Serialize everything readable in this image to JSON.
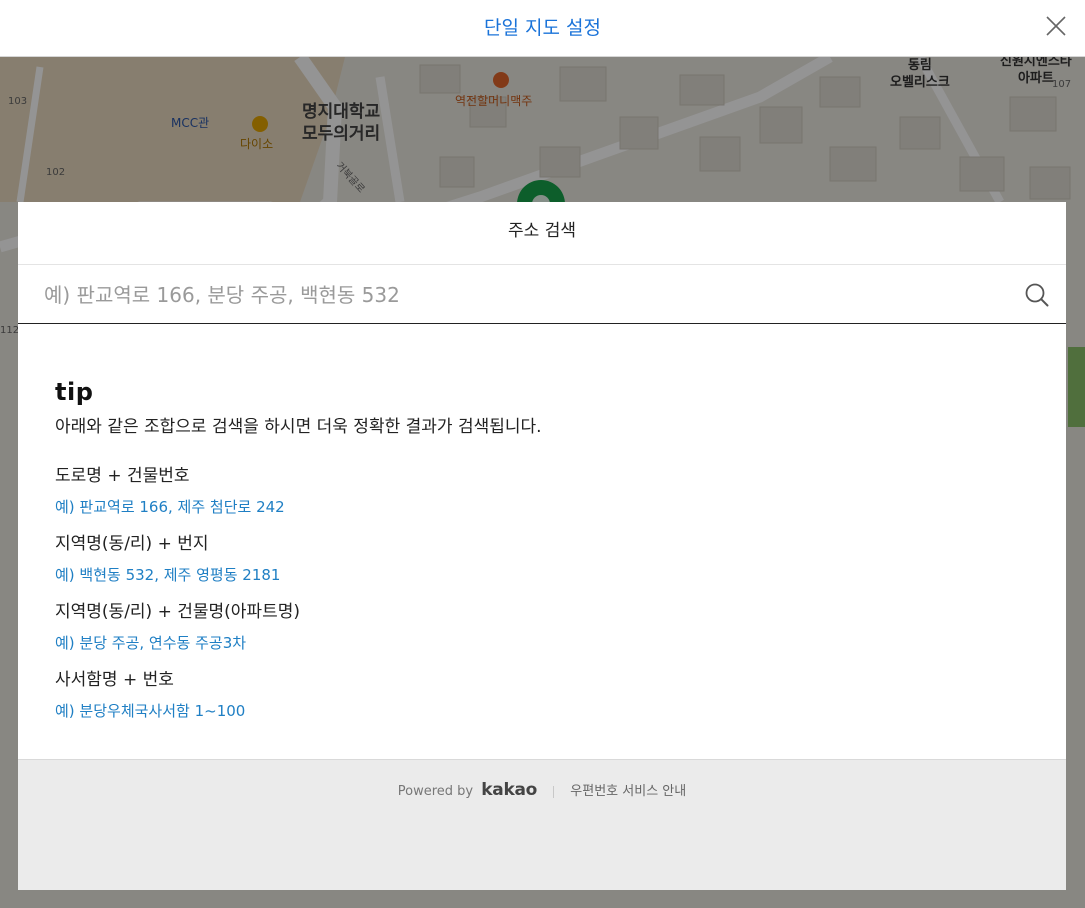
{
  "header": {
    "title": "단일 지도 설정",
    "close_icon": "close-icon"
  },
  "map": {
    "labels": {
      "mcc": "MCC관",
      "daiso": "다이소",
      "myongji_1": "명지대학교",
      "myongji_2": "모두의거리",
      "restaurant": "역전할머니맥주",
      "road": "거북골로",
      "obelisk_1": "동림",
      "obelisk_2": "오벨리스크",
      "apt_1": "신원시엔스타",
      "apt_2": "아파트",
      "n103": "103",
      "n102": "102",
      "n107": "107",
      "n112": "112"
    }
  },
  "modal": {
    "title": "주소 검색",
    "search": {
      "placeholder": "예) 판교역로 166, 분당 주공, 백현동 532",
      "value": "",
      "icon": "search-icon"
    },
    "tip": {
      "heading": "tip",
      "description": "아래와 같은 조합으로 검색을 하시면 더욱 정확한 결과가 검색됩니다.",
      "items": [
        {
          "title": "도로명 + 건물번호",
          "example": "예) 판교역로 166,  제주 첨단로 242"
        },
        {
          "title": "지역명(동/리) + 번지",
          "example": "예) 백현동 532,  제주 영평동 2181"
        },
        {
          "title": "지역명(동/리) + 건물명(아파트명)",
          "example": "예) 분당 주공,  연수동 주공3차"
        },
        {
          "title": "사서함명 + 번호",
          "example": "예) 분당우체국사서함 1~100"
        }
      ]
    },
    "footer": {
      "powered_by": "Powered by",
      "brand": "kakao",
      "service_link": "우편번호 서비스 안내"
    }
  },
  "colors": {
    "title_blue": "#1a73d9",
    "example_blue": "#1f7fc4",
    "footer_bg": "#ebebeb"
  }
}
